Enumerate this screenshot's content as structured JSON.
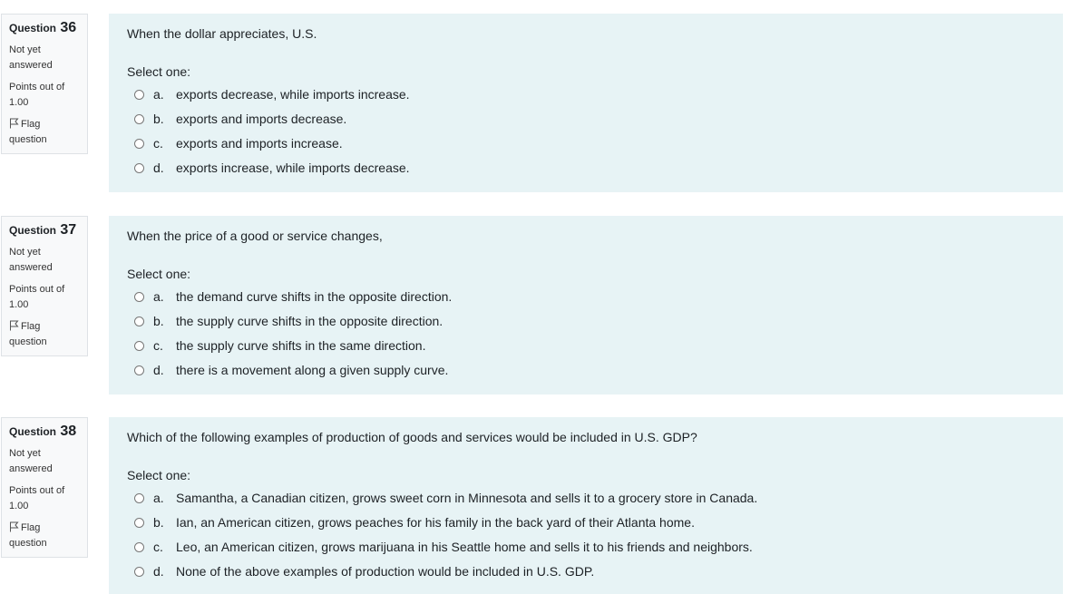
{
  "questions": [
    {
      "label": "Question",
      "number": "36",
      "state": "Not yet answered",
      "grade": "Points out of 1.00",
      "flag_label": "Flag question",
      "text": "When the dollar appreciates, U.S.",
      "prompt": "Select one:",
      "options": [
        {
          "letter": "a.",
          "text": "exports decrease, while imports increase."
        },
        {
          "letter": "b.",
          "text": "exports and imports decrease."
        },
        {
          "letter": "c.",
          "text": "exports and imports increase."
        },
        {
          "letter": "d.",
          "text": "exports increase, while imports decrease."
        }
      ]
    },
    {
      "label": "Question",
      "number": "37",
      "state": "Not yet answered",
      "grade": "Points out of 1.00",
      "flag_label": "Flag question",
      "text": "When the price of a good or service changes,",
      "prompt": "Select one:",
      "options": [
        {
          "letter": "a.",
          "text": "the demand curve shifts in the opposite direction."
        },
        {
          "letter": "b.",
          "text": "the supply curve shifts in the opposite direction."
        },
        {
          "letter": "c.",
          "text": "the supply curve shifts in the same direction."
        },
        {
          "letter": "d.",
          "text": "there is a movement along a given supply curve."
        }
      ]
    },
    {
      "label": "Question",
      "number": "38",
      "state": "Not yet answered",
      "grade": "Points out of 1.00",
      "flag_label": "Flag question",
      "text": "Which of the following examples of production of goods and services would be included in U.S. GDP?",
      "prompt": "Select one:",
      "options": [
        {
          "letter": "a.",
          "text": "Samantha, a Canadian citizen, grows sweet corn in Minnesota and sells it to a grocery store in Canada."
        },
        {
          "letter": "b.",
          "text": "Ian, an American citizen, grows peaches for his family in the back yard of their Atlanta home."
        },
        {
          "letter": "c.",
          "text": "Leo, an American citizen, grows marijuana in his Seattle home and sells it to his friends and neighbors."
        },
        {
          "letter": "d.",
          "text": "None of the above examples of production would be included in U.S. GDP."
        }
      ]
    }
  ],
  "colors": {
    "content_background": "#e7f3f5",
    "info_background": "#f8f9fa",
    "info_border": "#dee2e6"
  },
  "icons": {
    "flag": "flag-icon",
    "radio": "radio-button-unchecked"
  }
}
